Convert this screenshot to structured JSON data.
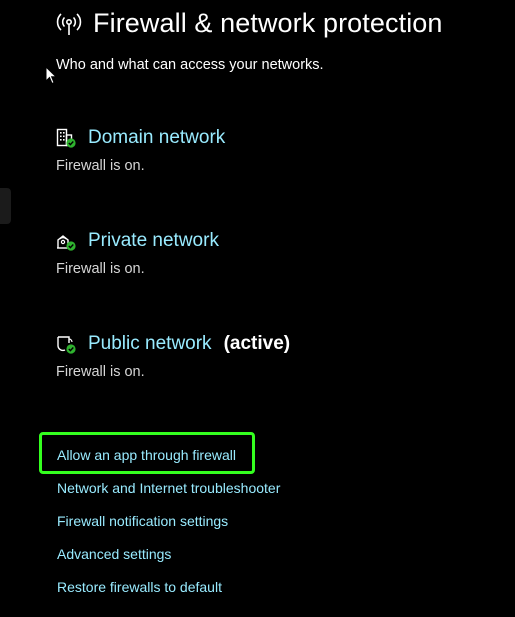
{
  "header": {
    "title": "Firewall & network protection",
    "subtitle": "Who and what can access your networks.",
    "icon": "wireless-signal-icon"
  },
  "networks": [
    {
      "title": "Domain network",
      "active_label": "",
      "status": "Firewall is on.",
      "icon": "domain-building-icon"
    },
    {
      "title": "Private network",
      "active_label": "",
      "status": "Firewall is on.",
      "icon": "private-network-icon"
    },
    {
      "title": "Public network",
      "active_label": "(active)",
      "status": "Firewall is on.",
      "icon": "public-network-icon"
    }
  ],
  "links": [
    {
      "label": "Allow an app through firewall",
      "highlighted": true
    },
    {
      "label": "Network and Internet troubleshooter"
    },
    {
      "label": "Firewall notification settings"
    },
    {
      "label": "Advanced settings"
    },
    {
      "label": "Restore firewalls to default"
    }
  ],
  "colors": {
    "background": "#000000",
    "link": "#99ebff",
    "status_ok": "#2fb32f",
    "highlight": "#34ff1f"
  }
}
